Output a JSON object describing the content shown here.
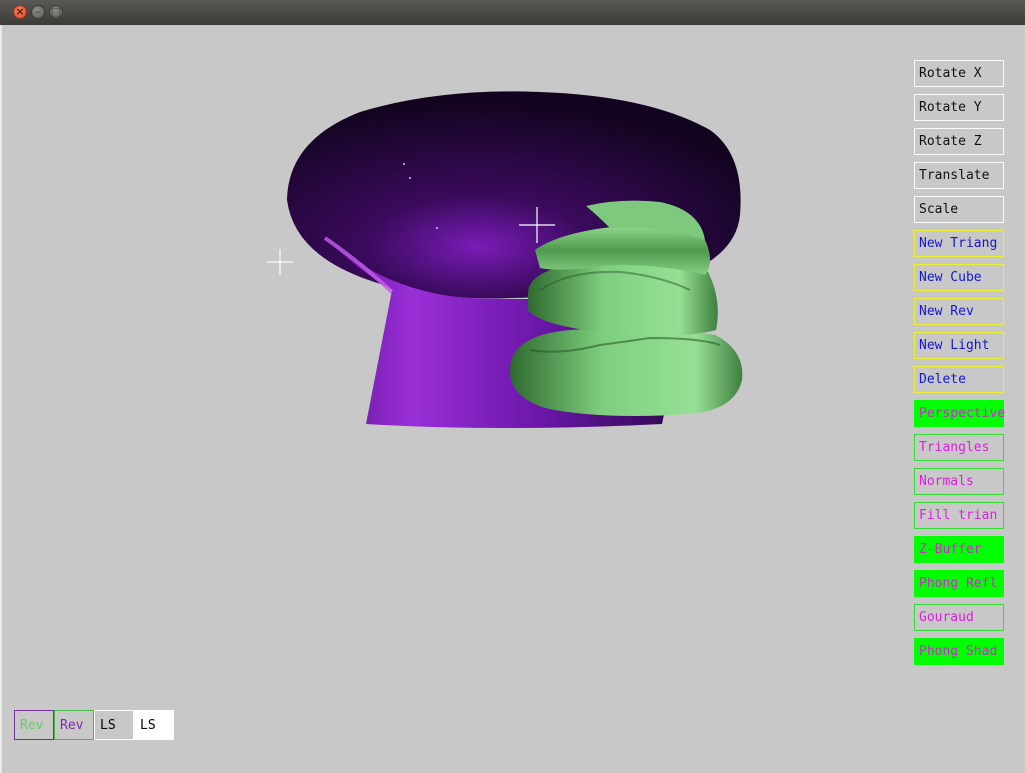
{
  "window": {
    "close_glyph": "×",
    "minimize_glyph": "–",
    "maximize_glyph": "□"
  },
  "toolbar": [
    {
      "label": "Rotate X",
      "style": "white"
    },
    {
      "label": "Rotate Y",
      "style": "white"
    },
    {
      "label": "Rotate Z",
      "style": "white"
    },
    {
      "label": "Translate",
      "style": "white"
    },
    {
      "label": "Scale",
      "style": "white"
    },
    {
      "label": "New Triang",
      "style": "yellow"
    },
    {
      "label": "New Cube",
      "style": "yellow"
    },
    {
      "label": "New Rev",
      "style": "yellow"
    },
    {
      "label": "New Light",
      "style": "yellow"
    },
    {
      "label": "Delete",
      "style": "yellow"
    },
    {
      "label": "Perspective",
      "style": "greenfill"
    },
    {
      "label": "Triangles",
      "style": "green"
    },
    {
      "label": "Normals",
      "style": "green"
    },
    {
      "label": "Fill trian",
      "style": "green"
    },
    {
      "label": "Z-Buffer",
      "style": "greenfill"
    },
    {
      "label": "Phong Refl",
      "style": "greenfill"
    },
    {
      "label": "Gouraud",
      "style": "green"
    },
    {
      "label": "Phong Shad",
      "style": "greenfill"
    }
  ],
  "objects": [
    {
      "label": "Rev",
      "border": "#7a2fa0",
      "text": "#66cc66",
      "bg": "transparent"
    },
    {
      "label": "Rev",
      "border": "#44bb44",
      "text": "#7a2fa0",
      "bg": "transparent"
    },
    {
      "label": "LS",
      "border": "#ffffff",
      "text": "#000000",
      "bg": "#c8c8c8"
    },
    {
      "label": "LS",
      "border": "#ffffff",
      "text": "#000000",
      "bg": "#ffffff"
    }
  ],
  "colors": {
    "purple_object": "#8a2be2",
    "green_object": "#7fcf7f",
    "canvas": "#c8c8c8"
  }
}
